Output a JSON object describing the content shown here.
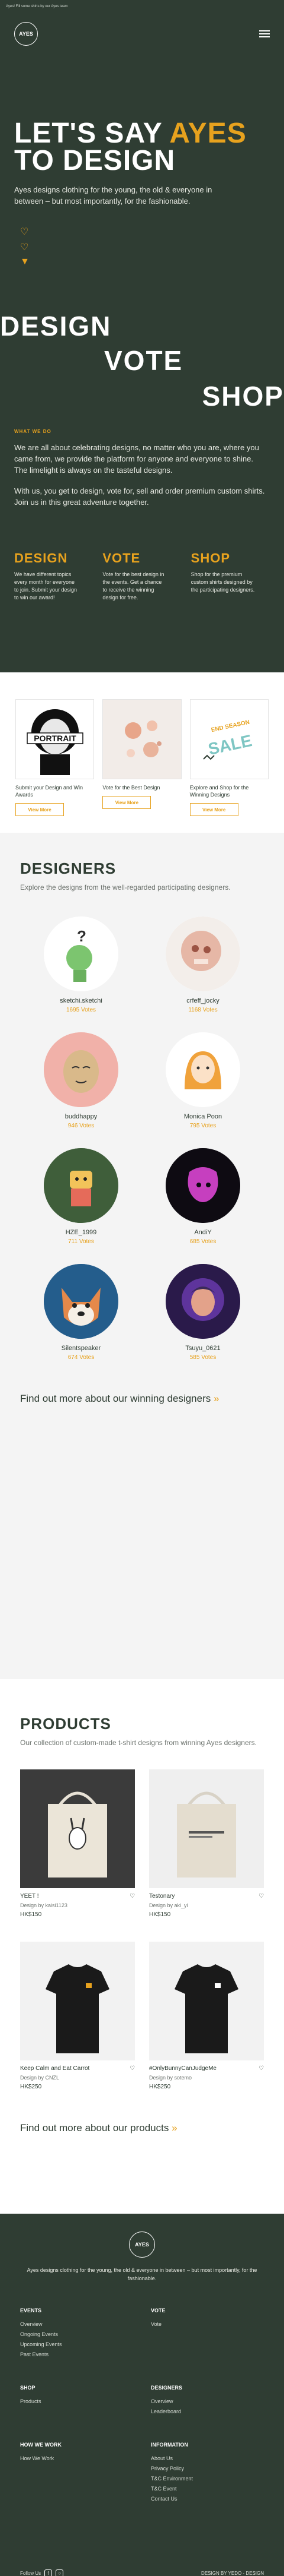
{
  "topbar": {
    "text": "Ayes! Fill some shirts by our Ayes team"
  },
  "header": {
    "logo_text": "AYES"
  },
  "hero": {
    "title_part1": "LET'S SAY ",
    "title_accent": "AYES",
    "title_part2": "TO DESIGN",
    "subtitle": "Ayes designs clothing for the young, the old & everyone in between – but most importantly, for the fashionable.",
    "words": [
      "DESIGN",
      "VOTE",
      "SHOP"
    ]
  },
  "what": {
    "label": "WHAT WE DO",
    "p1": "We are all about celebrating designs, no matter who you are, where you came from, we provide the platform for anyone and everyone to shine. The limelight is always on the tasteful designs.",
    "p2": "With us, you get to design, vote for, sell and order premium custom shirts. Join us in this great adventure together.",
    "columns": [
      {
        "title": "DESIGN",
        "text": "We have different topics every month for everyone to join. Submit your design to win our award!"
      },
      {
        "title": "VOTE",
        "text": "Vote for the best design in the events. Get a chance to receive the winning design for free."
      },
      {
        "title": "SHOP",
        "text": "Shop for the premium custom shirts designed by the participating designers."
      }
    ]
  },
  "cards": [
    {
      "title": "Submit your Design and Win Awards",
      "button": "View More",
      "art": "PORTRAIT"
    },
    {
      "title": "Vote for the Best Design",
      "button": "View More",
      "art": ""
    },
    {
      "title": "Explore and Shop for the Winning Designs",
      "button": "View More",
      "art": "SALE",
      "art_top": "END SEASON"
    }
  ],
  "designers": {
    "title": "DESIGNERS",
    "subtitle": "Explore the designs from the well-regarded participating designers.",
    "items": [
      {
        "name": "sketchi.sketchi",
        "votes": "1695 Votes",
        "bg": "#ffffff"
      },
      {
        "name": "crfeff_jocky",
        "votes": "1168 Votes",
        "bg": "#ffffff"
      },
      {
        "name": "buddhappy",
        "votes": "946 Votes",
        "bg": "#f1b1a9"
      },
      {
        "name": "Monica Poon",
        "votes": "795 Votes",
        "bg": "#ffffff"
      },
      {
        "name": "HZE_1999",
        "votes": "711 Votes",
        "bg": "#3f5e3a"
      },
      {
        "name": "AndiY",
        "votes": "685 Votes",
        "bg": "#0e0b12"
      },
      {
        "name": "Silentspeaker",
        "votes": "674 Votes",
        "bg": "#245d8c"
      },
      {
        "name": "Tsuyu_0621",
        "votes": "585 Votes",
        "bg": "#2a1a4a"
      }
    ],
    "find_more": "Find out more about our winning designers",
    "find_more_arrow": "»"
  },
  "products": {
    "title": "PRODUCTS",
    "subtitle": "Our collection of custom-made t-shirt designs from winning Ayes designers.",
    "items": [
      {
        "name": "YEET !",
        "by": "Design by kaisi1123",
        "price": "HK$150",
        "kind": "tote"
      },
      {
        "name": "Testonary",
        "by": "Design by aki_yi",
        "price": "HK$150",
        "kind": "tote"
      },
      {
        "name": "Keep Calm and Eat Carrot",
        "by": "Design by CNZL",
        "price": "HK$250",
        "kind": "shirt"
      },
      {
        "name": "#OnlyBunnyCanJudgeMe",
        "by": "Design by sotemo",
        "price": "HK$250",
        "kind": "shirt"
      }
    ],
    "find_more": "Find out more about our products",
    "find_more_arrow": "»"
  },
  "footer": {
    "logo_text": "AYES",
    "tagline": "Ayes designs clothing for the young, the old & everyone in between – but most importantly, for the fashionable.",
    "columns": [
      {
        "title": "EVENTS",
        "links": [
          "Overview",
          "Ongoing Events",
          "Upcoming Events",
          "Past Events"
        ]
      },
      {
        "title": "VOTE",
        "links": [
          "Vote"
        ]
      },
      {
        "title": "SHOP",
        "links": [
          "Products"
        ]
      },
      {
        "title": "DESIGNERS",
        "links": [
          "Overview",
          "Leaderboard"
        ]
      },
      {
        "title": "HOW WE WORK",
        "links": [
          "How We Work"
        ]
      },
      {
        "title": "INFORMATION",
        "links": [
          "About Us",
          "Privacy Policy",
          "T&C Environment",
          "T&C Event",
          "Contact Us"
        ]
      }
    ],
    "follow": "Follow Us",
    "credit": "DESIGN BY YEDO - DESIGN"
  }
}
